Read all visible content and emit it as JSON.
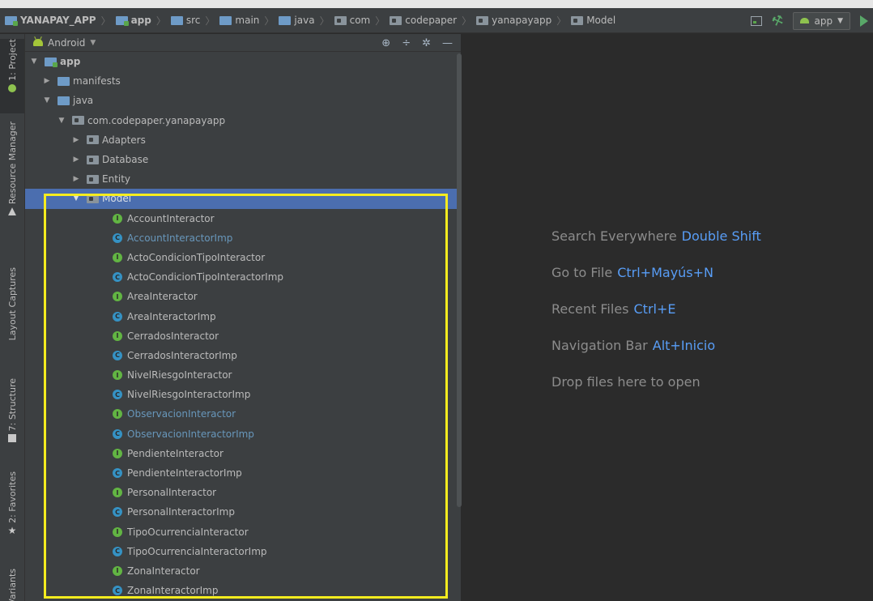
{
  "breadcrumb": [
    {
      "label": "YANAPAY_APP",
      "icon": "module-folder-icon",
      "kind": "project"
    },
    {
      "label": "app",
      "icon": "module-folder-icon",
      "kind": "app"
    },
    {
      "label": "src",
      "icon": "folder-icon",
      "kind": "dir"
    },
    {
      "label": "main",
      "icon": "folder-icon",
      "kind": "dir"
    },
    {
      "label": "java",
      "icon": "source-folder-icon",
      "kind": "dir"
    },
    {
      "label": "com",
      "icon": "package-icon",
      "kind": "pkg"
    },
    {
      "label": "codepaper",
      "icon": "package-icon",
      "kind": "pkg"
    },
    {
      "label": "yanapayapp",
      "icon": "package-icon",
      "kind": "pkg"
    },
    {
      "label": "Model",
      "icon": "package-icon",
      "kind": "pkg"
    }
  ],
  "toolbar": {
    "run_config": "app"
  },
  "tool_stripe": {
    "project": "1: Project",
    "resource_manager": "Resource Manager",
    "layout_captures": "Layout Captures",
    "structure": "7: Structure",
    "favorites": "2: Favorites",
    "variants": "Build Variants"
  },
  "panel": {
    "view_mode": "Android"
  },
  "tree": {
    "root": "app",
    "manifests": "manifests",
    "java": "java",
    "package": "com.codepaper.yanapayapp",
    "subpackages": [
      "Adapters",
      "Database",
      "Entity"
    ],
    "model": "Model",
    "classes": [
      {
        "name": "AccountInteractor",
        "kind": "interface",
        "modified": false
      },
      {
        "name": "AccountInteractorImp",
        "kind": "class",
        "modified": true
      },
      {
        "name": "ActoCondicionTipoInteractor",
        "kind": "interface",
        "modified": false
      },
      {
        "name": "ActoCondicionTipoInteractorImp",
        "kind": "class",
        "modified": false
      },
      {
        "name": "AreaInteractor",
        "kind": "interface",
        "modified": false
      },
      {
        "name": "AreaInteractorImp",
        "kind": "class",
        "modified": false
      },
      {
        "name": "CerradosInteractor",
        "kind": "interface",
        "modified": false
      },
      {
        "name": "CerradosInteractorImp",
        "kind": "class",
        "modified": false
      },
      {
        "name": "NivelRiesgoInteractor",
        "kind": "interface",
        "modified": false
      },
      {
        "name": "NivelRiesgoInteractorImp",
        "kind": "class",
        "modified": false
      },
      {
        "name": "ObservacionInteractor",
        "kind": "interface",
        "modified": true
      },
      {
        "name": "ObservacionInteractorImp",
        "kind": "class",
        "modified": true
      },
      {
        "name": "PendienteInteractor",
        "kind": "interface",
        "modified": false
      },
      {
        "name": "PendienteInteractorImp",
        "kind": "class",
        "modified": false
      },
      {
        "name": "PersonalInteractor",
        "kind": "interface",
        "modified": false
      },
      {
        "name": "PersonalInteractorImp",
        "kind": "class",
        "modified": false
      },
      {
        "name": "TipoOcurrenciaInteractor",
        "kind": "interface",
        "modified": false
      },
      {
        "name": "TipoOcurrenciaInteractorImp",
        "kind": "class",
        "modified": false
      },
      {
        "name": "ZonaInteractor",
        "kind": "interface",
        "modified": false
      },
      {
        "name": "ZonaInteractorImp",
        "kind": "class",
        "modified": false
      }
    ]
  },
  "editor_hints": [
    {
      "text": "Search Everywhere",
      "key": "Double Shift"
    },
    {
      "text": "Go to File",
      "key": "Ctrl+Mayús+N"
    },
    {
      "text": "Recent Files",
      "key": "Ctrl+E"
    },
    {
      "text": "Navigation Bar",
      "key": "Alt+Inicio"
    },
    {
      "text": "Drop files here to open",
      "key": ""
    }
  ],
  "colors": {
    "selection": "#4b6eaf",
    "interface_icon": "#62b543",
    "class_icon": "#3592c4",
    "modified_text": "#6897bb",
    "shortcut": "#589df6",
    "highlight_box": "#f5ec1f"
  }
}
